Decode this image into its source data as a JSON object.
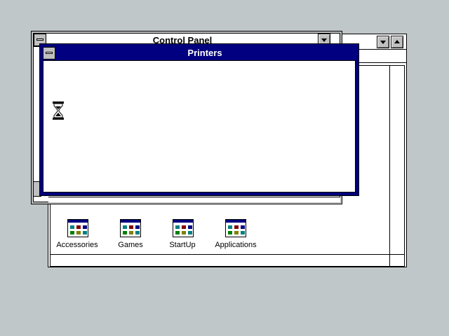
{
  "control_panel": {
    "title": "Control Panel"
  },
  "printers": {
    "title": "Printers"
  },
  "program_groups": [
    {
      "label": "Accessories"
    },
    {
      "label": "Games"
    },
    {
      "label": "StartUp"
    },
    {
      "label": "Applications"
    }
  ],
  "cursor": {
    "icon": "hourglass-icon"
  },
  "colors": {
    "desktop": "#c0c7c8",
    "active_title": "#000080",
    "window": "#ffffff"
  }
}
